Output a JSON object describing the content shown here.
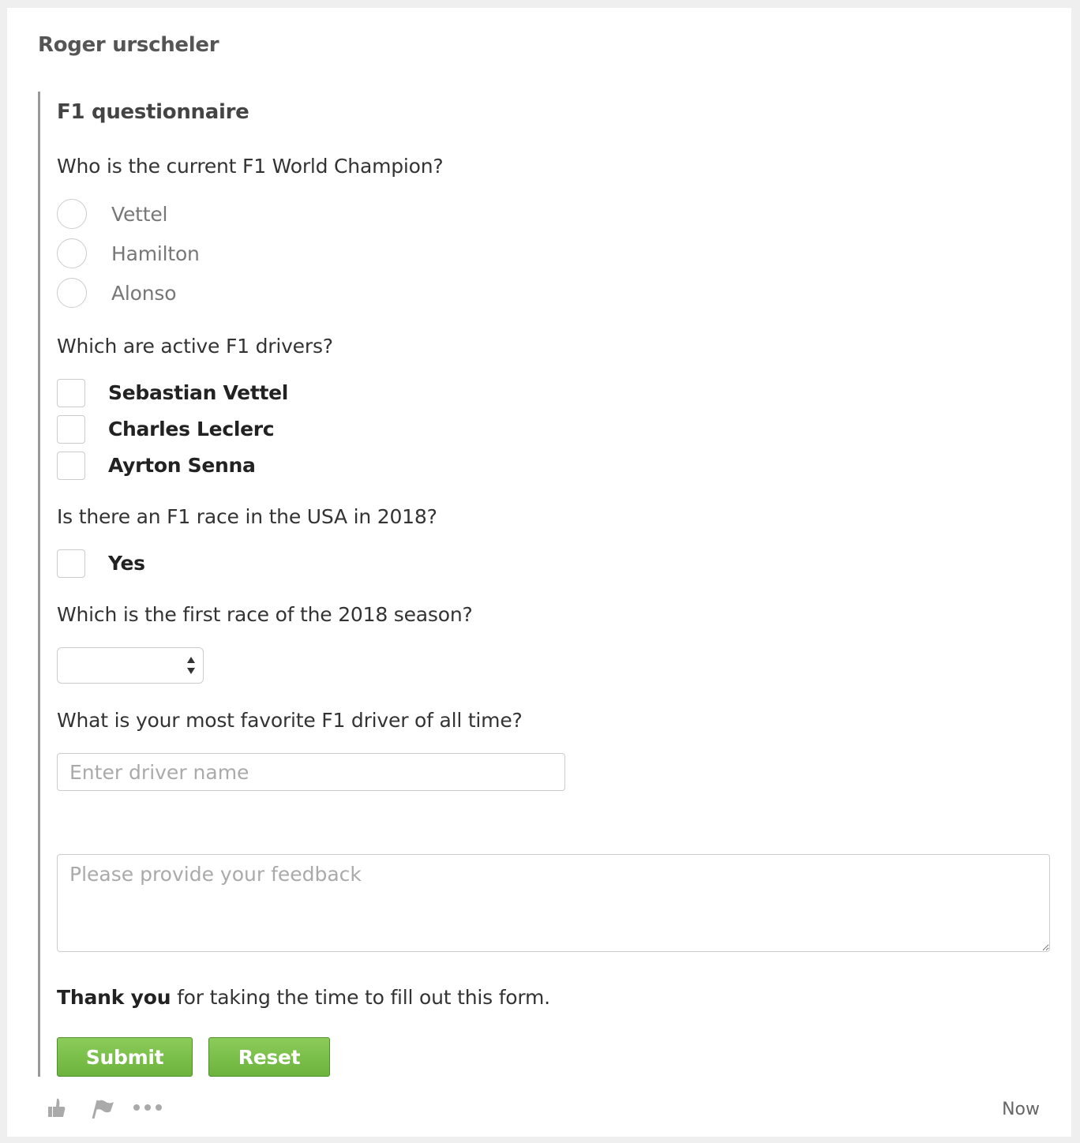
{
  "post": {
    "author": "Roger urscheler",
    "time": "Now"
  },
  "form": {
    "title": "F1 questionnaire",
    "q1": {
      "text": "Who is the current F1 World Champion?",
      "options": [
        "Vettel",
        "Hamilton",
        "Alonso"
      ]
    },
    "q2": {
      "text": "Which are active F1 drivers?",
      "options": [
        "Sebastian Vettel",
        "Charles Leclerc",
        "Ayrton Senna"
      ]
    },
    "q3": {
      "text": "Is there an F1 race in the USA in 2018?",
      "option": "Yes"
    },
    "q4": {
      "text": "Which is the first race of the 2018 season?",
      "selected": ""
    },
    "q5": {
      "text": "What is your most favorite F1 driver of all time?",
      "placeholder": "Enter driver name",
      "value": ""
    },
    "feedback": {
      "placeholder": "Please provide your feedback",
      "value": ""
    },
    "thanks": {
      "bold": "Thank you",
      "rest": " for taking the time to fill out this form."
    },
    "buttons": {
      "submit": "Submit",
      "reset": "Reset"
    }
  },
  "footer": {
    "icons": [
      "thumbs-up-icon",
      "flag-icon",
      "more-icon"
    ]
  },
  "colors": {
    "button_green": "#7bbf4a",
    "border_gray": "#999999"
  }
}
